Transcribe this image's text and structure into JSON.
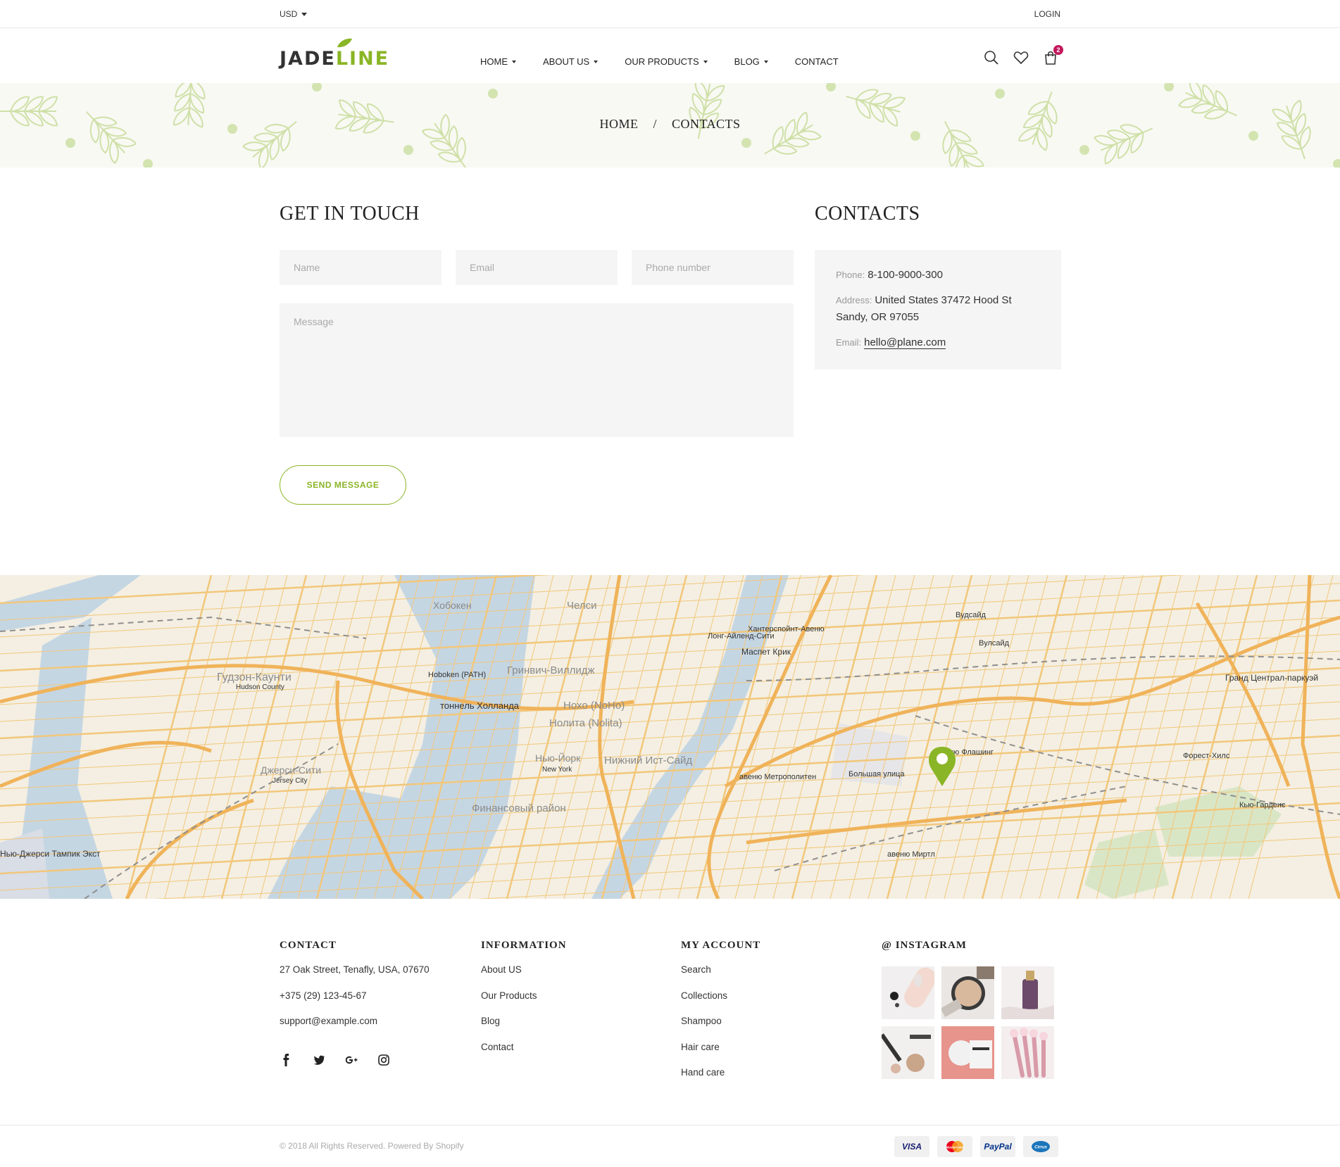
{
  "topbar": {
    "currency": "USD",
    "login": "LOGIN"
  },
  "logo": {
    "part1": "JADE",
    "part2": "LINE"
  },
  "nav": {
    "items": [
      {
        "label": "HOME",
        "dropdown": true
      },
      {
        "label": "ABOUT US",
        "dropdown": true
      },
      {
        "label": "OUR PRODUCTS",
        "dropdown": true
      },
      {
        "label": "BLOG",
        "dropdown": true
      },
      {
        "label": "CONTACT",
        "dropdown": false
      }
    ]
  },
  "header": {
    "cart_count": "2"
  },
  "breadcrumb": {
    "home": "HOME",
    "sep": "/",
    "current": "CONTACTS"
  },
  "form": {
    "title": "GET IN TOUCH",
    "name_placeholder": "Name",
    "email_placeholder": "Email",
    "phone_placeholder": "Phone number",
    "message_placeholder": "Message",
    "submit": "SEND MESSAGE"
  },
  "contacts": {
    "title": "CONTACTS",
    "phone_label": "Phone:",
    "phone": "8-100-9000-300",
    "address_label": "Address:",
    "address": "United States 37472 Hood St Sandy, OR 97055",
    "email_label": "Email:",
    "email": "hello@plane.com"
  },
  "map": {
    "labels": [
      "Хобокен",
      "Челси",
      "Гудзон-Каунти",
      "Hudson County",
      "Hoboken (PATH)",
      "Гринвич-Виллидж",
      "тоннель Холланда",
      "Нохо (NoHo)",
      "Нолита (Nolita)",
      "Нью-Йорк",
      "New York",
      "Нижний Ист-Сайд",
      "Джерси-Сити",
      "Jersey City",
      "Финансовый район",
      "Лонг-Айленд-Сити",
      "Хантерспойнт-Авеню",
      "Маспет Крик",
      "Вудсайд",
      "Вулсайд",
      "авеню Метрополитен",
      "Большая улица",
      "авеню Флашинг",
      "авеню Миртл",
      "Форест-Хилс",
      "Кью-Гарденс",
      "Гранд Централ-паркуэй",
      "Нью-Джерси Тампик Экст"
    ],
    "pin_color": "#8ab526"
  },
  "footer": {
    "contact": {
      "title": "CONTACT",
      "address": "27 Oak Street, Tenafly, USA, 07670",
      "phone": "+375 (29) 123-45-67",
      "email": "support@example.com"
    },
    "information": {
      "title": "INFORMATION",
      "links": [
        "About US",
        "Our Products",
        "Blog",
        "Contact"
      ]
    },
    "account": {
      "title": "MY ACCOUNT",
      "links": [
        "Search",
        "Collections",
        "Shampoo",
        "Hair care",
        "Hand care"
      ]
    },
    "instagram": {
      "title": "@ INSTAGRAM"
    },
    "copyright": "© 2018 All Rights Reserved. Powered By Shopify",
    "payments": [
      "VISA",
      "MasterCard",
      "PayPal",
      "Cirrus"
    ]
  },
  "colors": {
    "accent": "#8ab526",
    "badge": "#c2185b",
    "field_bg": "#f5f5f5"
  }
}
